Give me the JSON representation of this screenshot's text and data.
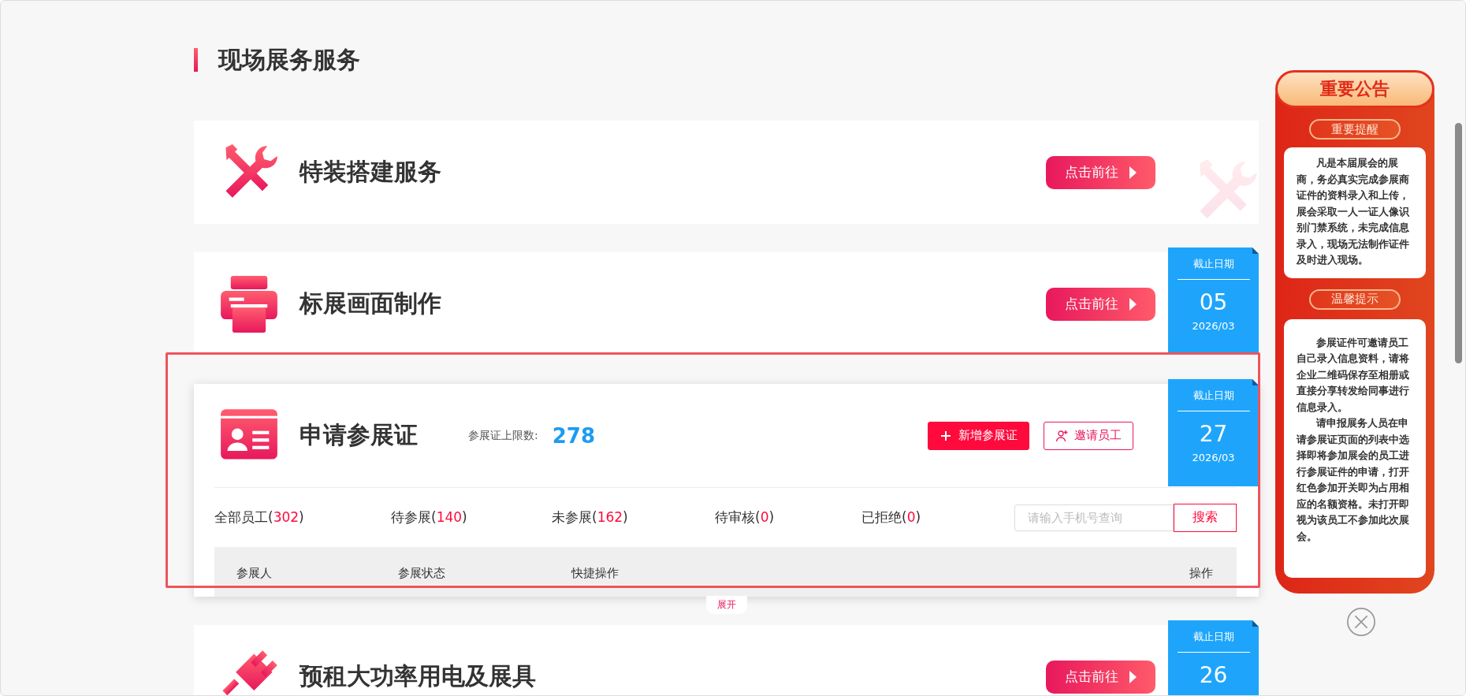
{
  "section_title": "现场展务服务",
  "services": [
    {
      "kind": "link",
      "title": "特装搭建服务",
      "button": "点击前往",
      "watermark": true
    },
    {
      "kind": "link",
      "title": "标展画面制作",
      "button": "点击前往",
      "deadline": {
        "label": "截止日期",
        "day": "05",
        "month": "2026/03"
      }
    },
    {
      "kind": "apply",
      "title": "申请参展证",
      "highlighted": true,
      "limit_label": "参展证上限数:",
      "limit_value": "278",
      "actions": [
        {
          "kind": "primary",
          "label": "新增参展证"
        },
        {
          "kind": "outline",
          "label": "邀请员工"
        }
      ],
      "deadline": {
        "label": "截止日期",
        "day": "27",
        "month": "2026/03"
      },
      "tabs": [
        {
          "label": "全部员工(",
          "count": "302",
          "close": ")",
          "selected": false
        },
        {
          "label": "待参展(",
          "count": "140",
          "close": ")",
          "selected": false
        },
        {
          "label": "未参展(",
          "count": "162",
          "close": ")",
          "selected": false
        },
        {
          "label": "待审核(",
          "count": "0",
          "close": ")",
          "selected": false
        },
        {
          "label": "已拒绝(",
          "count": "0",
          "close": ")",
          "selected": false
        }
      ],
      "search": {
        "placeholder": "请输入手机号查询",
        "button": "搜索"
      },
      "table": {
        "columns": [
          "参展人",
          "参展状态",
          "快捷操作",
          "操作"
        ]
      },
      "expand": "展开"
    },
    {
      "kind": "link",
      "title": "预租大功率用电及展具",
      "button": "点击前往",
      "deadline": {
        "label": "截止日期",
        "day": "26"
      }
    }
  ],
  "notice": {
    "title": "重要公告",
    "sections": [
      {
        "heading": "重要提醒",
        "paragraphs": [
          "凡是本届展会的展商，务必真实完成参展商证件的资料录入和上传，展会采取一人一证人像识别门禁系统，未完成信息录入，现场无法制作证件及时进入现场。"
        ]
      },
      {
        "heading": "温馨提示",
        "paragraphs": [
          "参展证件可邀请员工自己录入信息资料，请将企业二维码保存至相册或直接分享转发给同事进行信息录入。",
          "请申报展务人员在申请参展证页面的列表中选择即将参加展会的员工进行参展证件的申请，打开红色参加开关即为占用相应的名额资格。未打开即视为该员工不参加此次展会。"
        ]
      }
    ]
  }
}
